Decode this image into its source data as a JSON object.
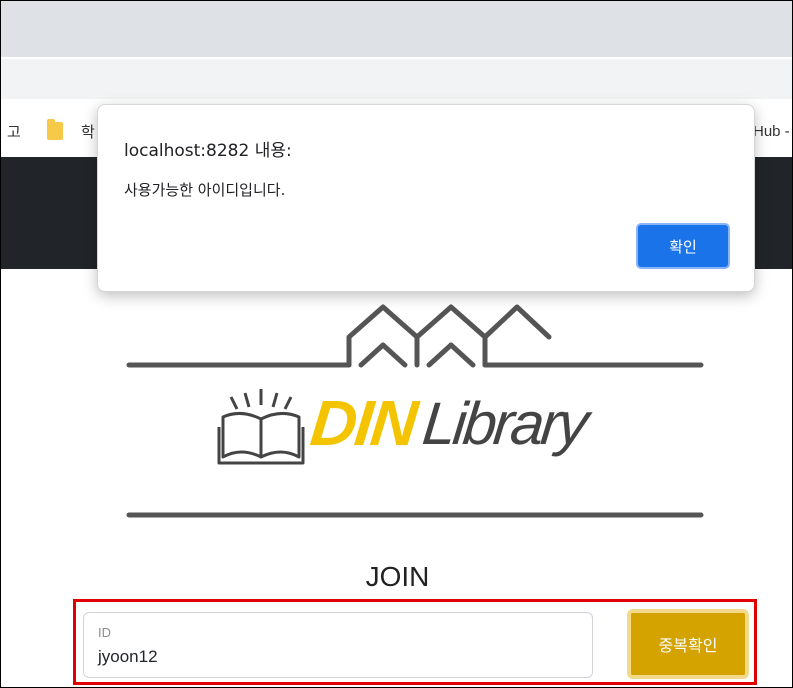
{
  "browser": {
    "bookmarks_left_text": "고",
    "bookmark_folder_label": "학",
    "bookmarks_right_text": "Hub -"
  },
  "dialog": {
    "title": "localhost:8282 내용:",
    "message": "사용가능한 아이디입니다.",
    "ok_label": "확인"
  },
  "logo": {
    "din": "DIN",
    "library": "Library"
  },
  "join": {
    "title": "JOIN",
    "id_label": "ID",
    "id_value": "jyoon12",
    "check_button_label": "중복확인"
  },
  "colors": {
    "accent_yellow": "#f5c400",
    "button_gold": "#d4a300",
    "dialog_button_blue": "#1a73e8",
    "highlight_red": "#e00000"
  }
}
